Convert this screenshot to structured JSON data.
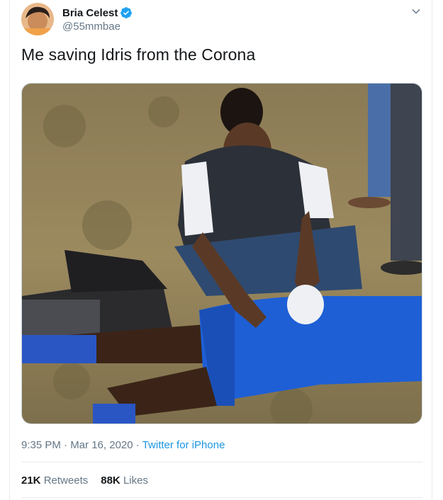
{
  "tweet": {
    "display_name": "Bria Celest",
    "handle": "@55mmbae",
    "verified": true,
    "text": "Me saving Idris from the Corona",
    "time": "9:35 PM",
    "separator": "·",
    "date": "Mar 16, 2020",
    "source": "Twitter for iPhone",
    "retweets_count": "21K",
    "retweets_label": "Retweets",
    "likes_count": "88K",
    "likes_label": "Likes"
  },
  "icons": {
    "verified": "verified-badge-icon",
    "more": "chevron-down-icon"
  },
  "colors": {
    "accent": "#1da1f2",
    "link": "#1b95e0",
    "muted": "#657786",
    "text": "#14171a",
    "border": "#e6ecf0"
  }
}
